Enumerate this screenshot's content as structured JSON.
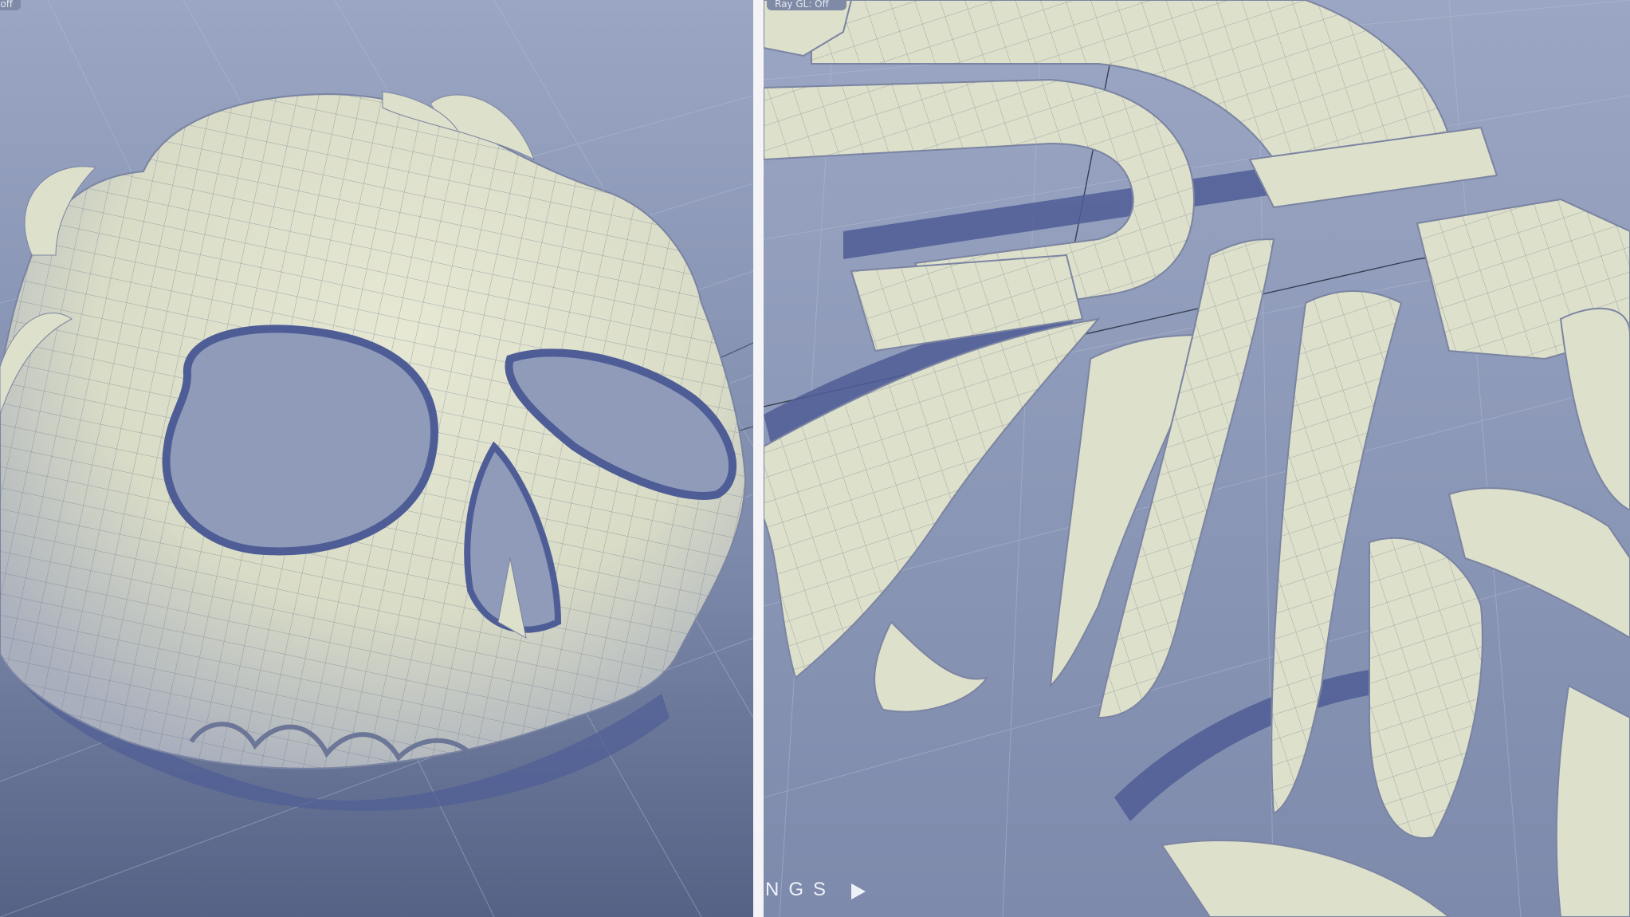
{
  "left_viewport": {
    "status": "off",
    "subject": "skull"
  },
  "right_viewport": {
    "status": "Ray GL: Off",
    "nav": {
      "label": "NGS",
      "play_icon": "play-icon"
    }
  },
  "colors": {
    "background": "#8c9ab8",
    "surface": "#dfe2cc",
    "shadow": "#4f5d96",
    "wire": "#3f4760"
  }
}
